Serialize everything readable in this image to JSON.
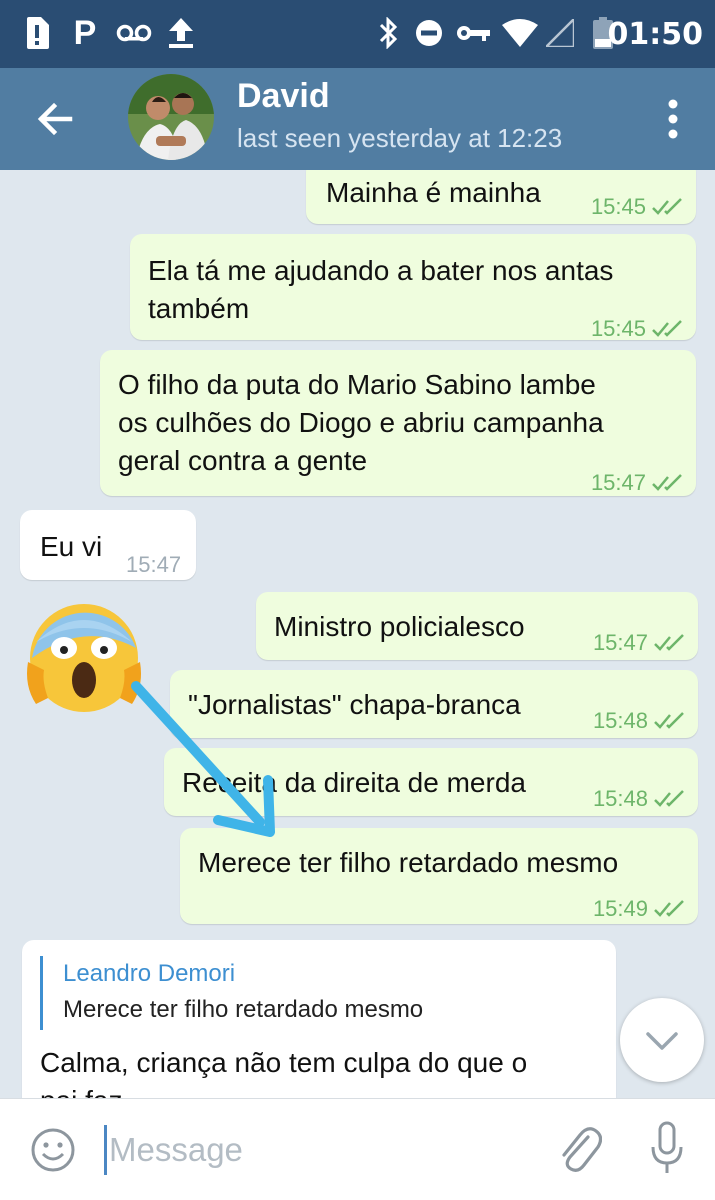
{
  "status_bar": {
    "time": "01:50",
    "icons": [
      "sim-alert-icon",
      "parking-icon",
      "voicemail-icon",
      "upload-icon",
      "bluetooth-icon",
      "do-not-disturb-icon",
      "vpn-key-icon",
      "wifi-icon",
      "signal-icon",
      "battery-icon"
    ]
  },
  "header": {
    "contact_name": "David",
    "last_seen": "last seen yesterday at 12:23"
  },
  "messages": [
    {
      "direction": "out",
      "lines": [
        "Mainha é mainha"
      ],
      "time": "15:45",
      "read": true
    },
    {
      "direction": "out",
      "lines": [
        "Ela tá me ajudando a bater nos antas",
        "também"
      ],
      "time": "15:45",
      "read": true
    },
    {
      "direction": "out",
      "lines": [
        "O filho da puta do Mario Sabino lambe",
        "os culhões do Diogo e abriu campanha",
        "geral contra a gente"
      ],
      "time": "15:47",
      "read": true
    },
    {
      "direction": "in",
      "lines": [
        "Eu vi"
      ],
      "time": "15:47"
    },
    {
      "direction": "out",
      "lines": [
        "Ministro policialesco"
      ],
      "time": "15:47",
      "read": true
    },
    {
      "direction": "out",
      "lines": [
        "\"Jornalistas\" chapa-branca"
      ],
      "time": "15:48",
      "read": true
    },
    {
      "direction": "out",
      "lines": [
        "Receita da direita de merda"
      ],
      "time": "15:48",
      "read": true
    },
    {
      "direction": "out",
      "lines": [
        "Merece ter filho retardado mesmo"
      ],
      "time": "15:49",
      "read": true
    },
    {
      "direction": "in",
      "reply_to": {
        "author": "Leandro Demori",
        "text": "Merece ter filho retardado mesmo"
      },
      "lines": [
        "Calma, criança não tem culpa do que o",
        "pai faz"
      ]
    }
  ],
  "overlay": {
    "emoji": "face-screaming-in-fear",
    "arrow_color": "#3fb4e8"
  },
  "input": {
    "placeholder": "Message"
  },
  "colors": {
    "header": "#517da2",
    "status_bar": "#2a4d73",
    "outgoing_bubble": "#effdde",
    "incoming_bubble": "#ffffff",
    "chat_background": "#dfe7ee",
    "check_marks": "#6db56a",
    "reply_author": "#3d8fd1"
  }
}
